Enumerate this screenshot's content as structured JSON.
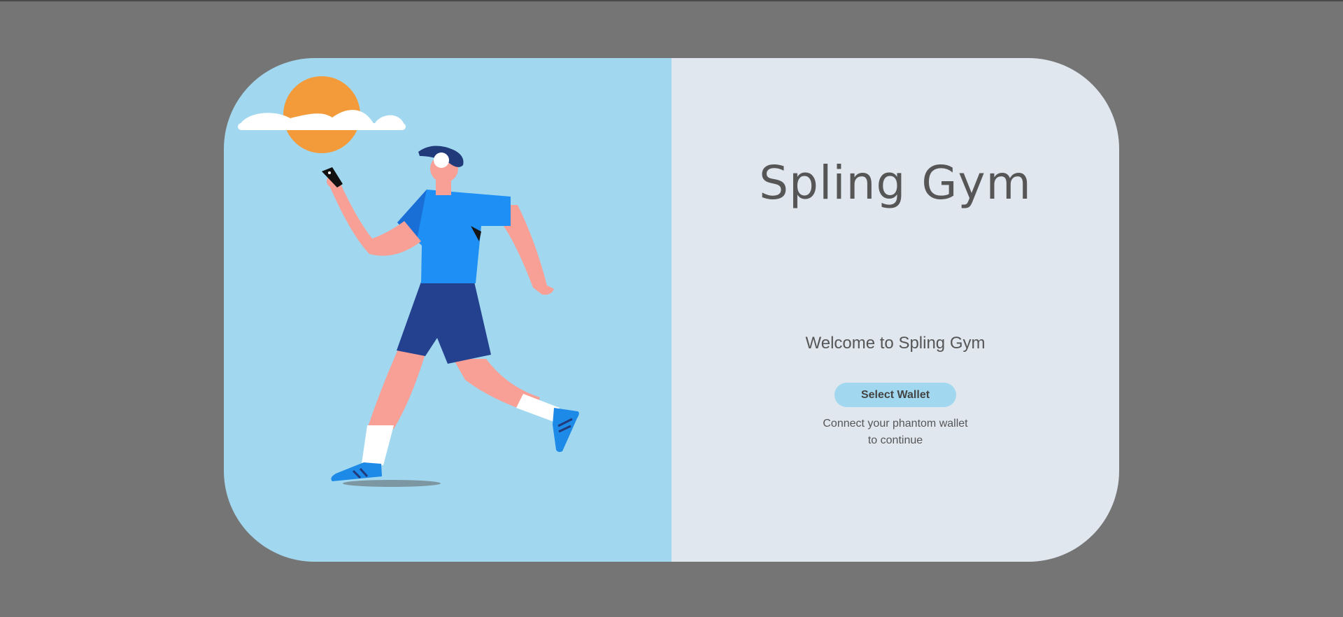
{
  "app": {
    "brand_title": "Spling Gym",
    "welcome_text": "Welcome to Spling Gym",
    "select_wallet_label": "Select Wallet",
    "hint_line1": "Connect your phantom wallet",
    "hint_line2": "to continue"
  },
  "colors": {
    "background": "#757575",
    "left_panel": "#a2d8ef",
    "right_panel": "#e1e7ef",
    "button": "#a2d8ef",
    "text": "#565656"
  },
  "icons": {
    "illustration": "runner-with-phone-illustration",
    "sun": "sun-behind-cloud-icon"
  }
}
